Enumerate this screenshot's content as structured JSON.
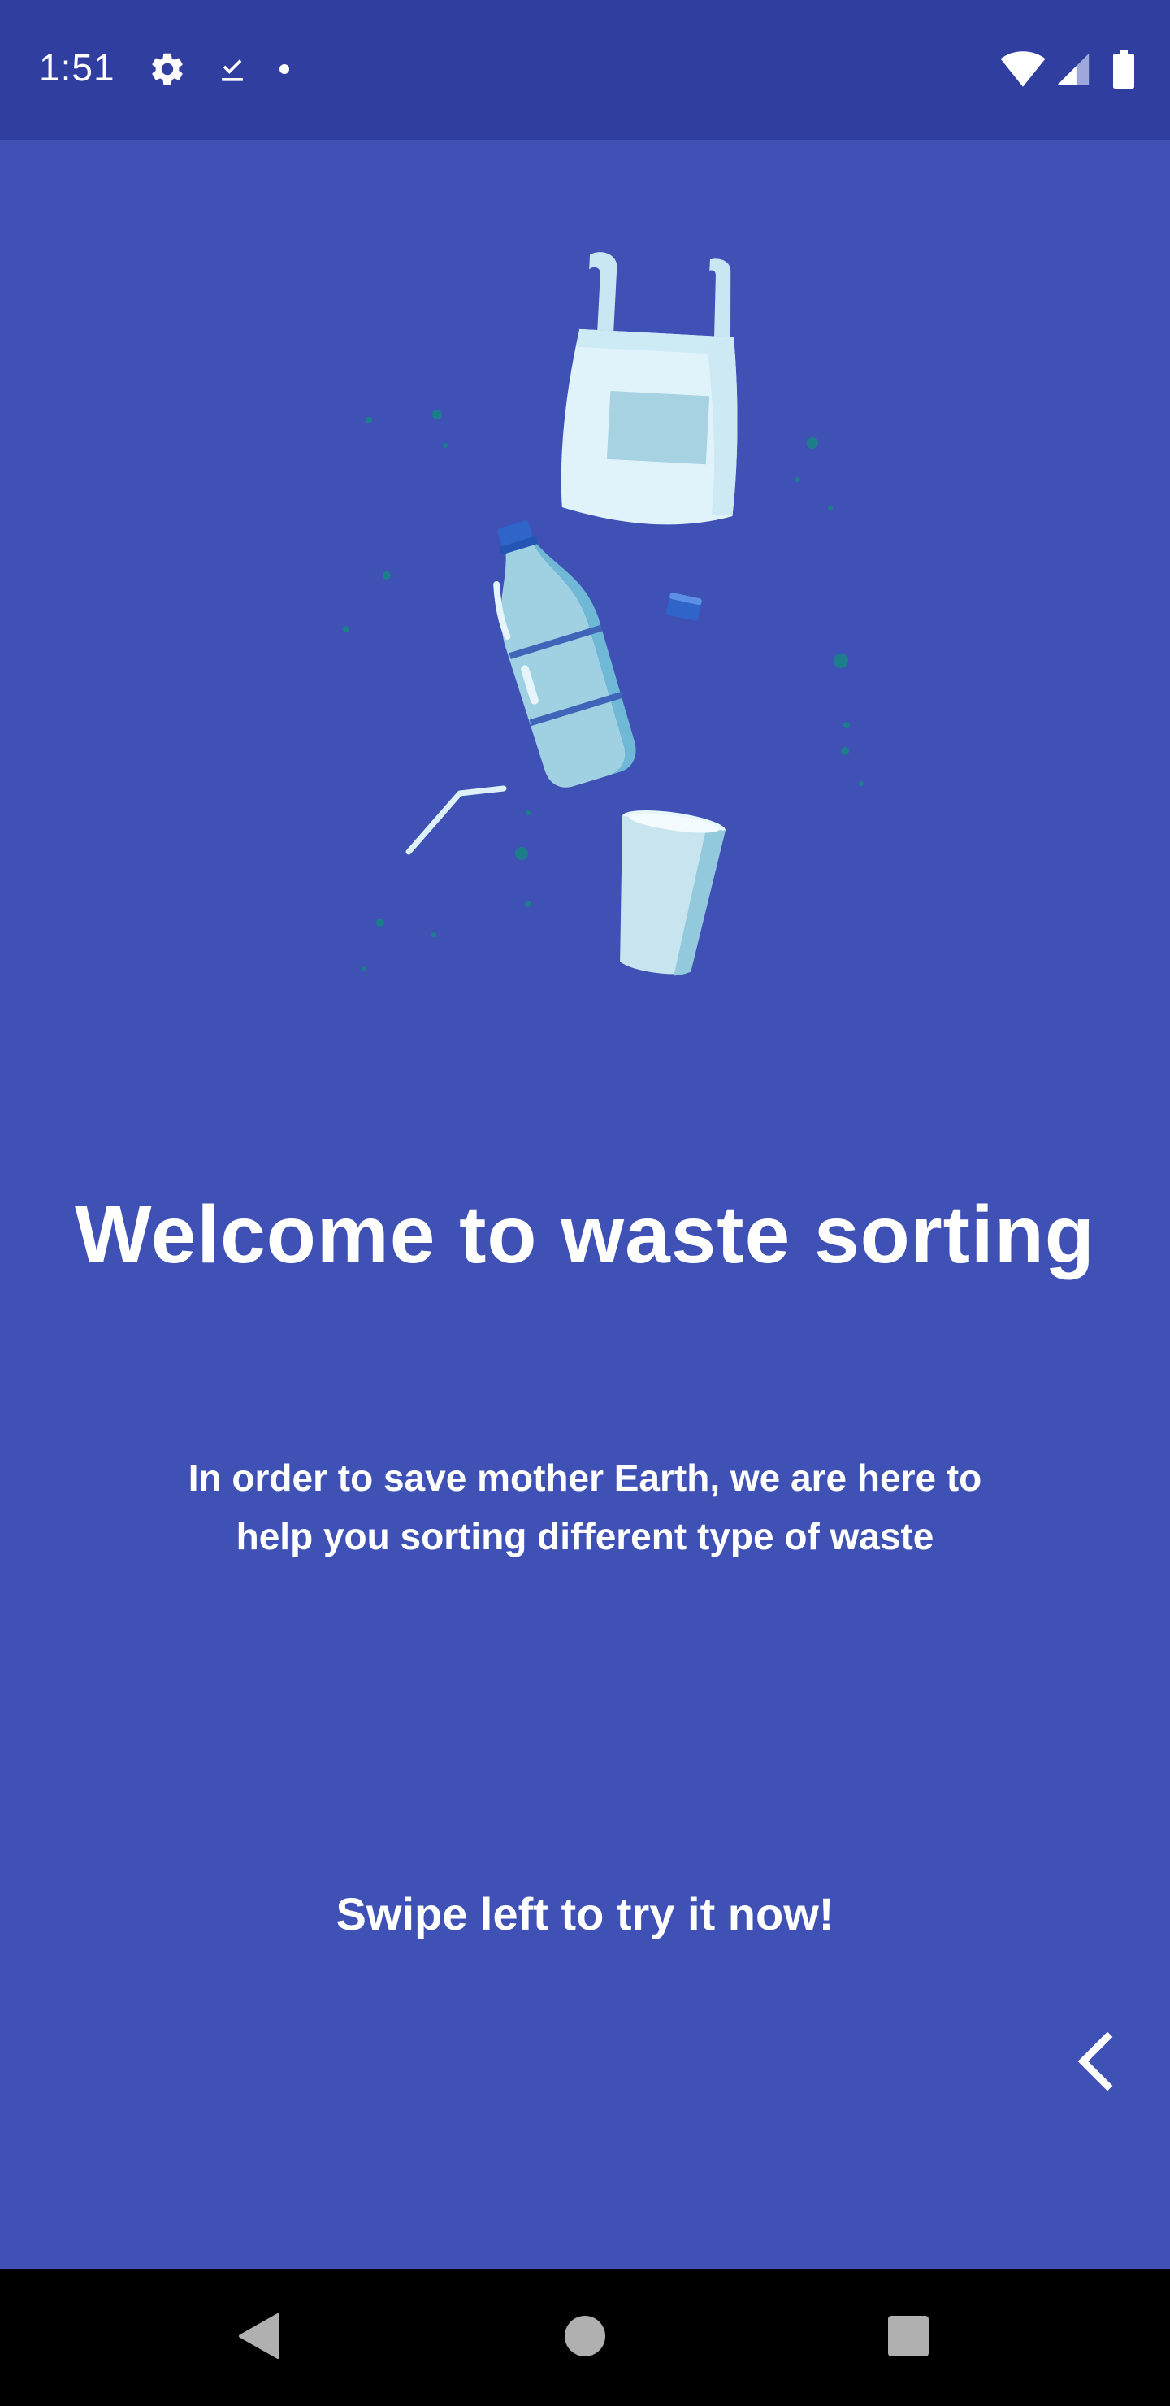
{
  "status_bar": {
    "time": "1:51",
    "left_icons": [
      "settings-icon",
      "download-done-icon",
      "notification-dot-icon"
    ],
    "right_icons": [
      "wifi-icon",
      "cell-signal-icon",
      "battery-icon"
    ],
    "background": "#303f9f"
  },
  "theme": {
    "background": "#3f51b5",
    "text": "#ffffff",
    "accent_dots": "#1b7e8a"
  },
  "illustration": {
    "items": [
      "plastic-bag",
      "plastic-bottle",
      "bottle-cap",
      "drinking-straw",
      "plastic-cup"
    ]
  },
  "onboarding": {
    "title": "Welcome to waste sorting",
    "subtitle_line1": "In order to save mother Earth, we are here to",
    "subtitle_line2": "help you sorting different type of waste",
    "swipe_hint": "Swipe left to try it now!",
    "back_icon": "chevron-left-icon"
  },
  "navigation_bar": {
    "buttons": [
      "back-triangle-icon",
      "home-circle-icon",
      "recents-square-icon"
    ]
  }
}
